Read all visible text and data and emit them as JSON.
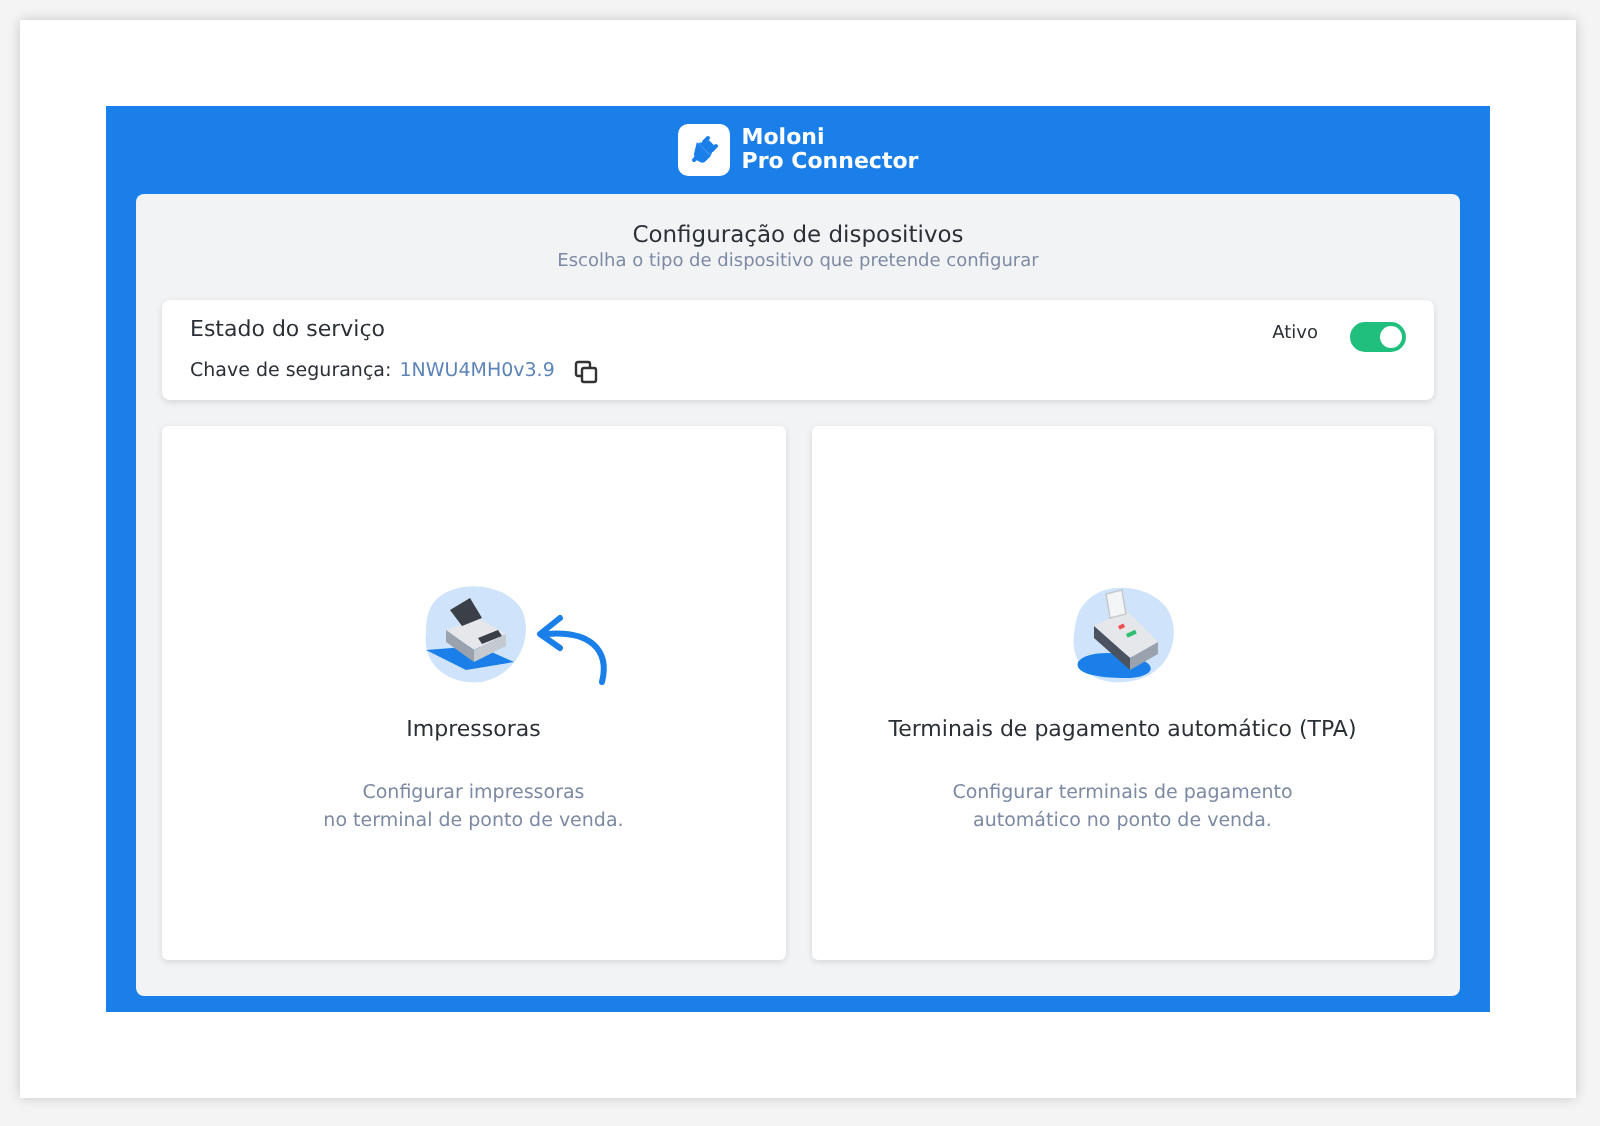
{
  "header": {
    "logo_line_1": "Moloni",
    "logo_line_2": "Pro Connector"
  },
  "panel": {
    "title": "Configuração de dispositivos",
    "subtitle": "Escolha o tipo de dispositivo que pretende configurar"
  },
  "service": {
    "title": "Estado do serviço",
    "key_label": "Chave de segurança:",
    "key_value": "1NWU4MH0v3.9",
    "status_label": "Ativo",
    "on": true
  },
  "devices": [
    {
      "kind": "printer",
      "title": "Impressoras",
      "description_lines": [
        "Configurar impressoras",
        "no terminal de ponto de venda."
      ],
      "pointer": true
    },
    {
      "kind": "terminal",
      "title": "Terminais de pagamento automático (TPA)",
      "description_lines": [
        "Configurar terminais de pagamento",
        "automático no ponto de venda."
      ],
      "pointer": false
    }
  ]
}
